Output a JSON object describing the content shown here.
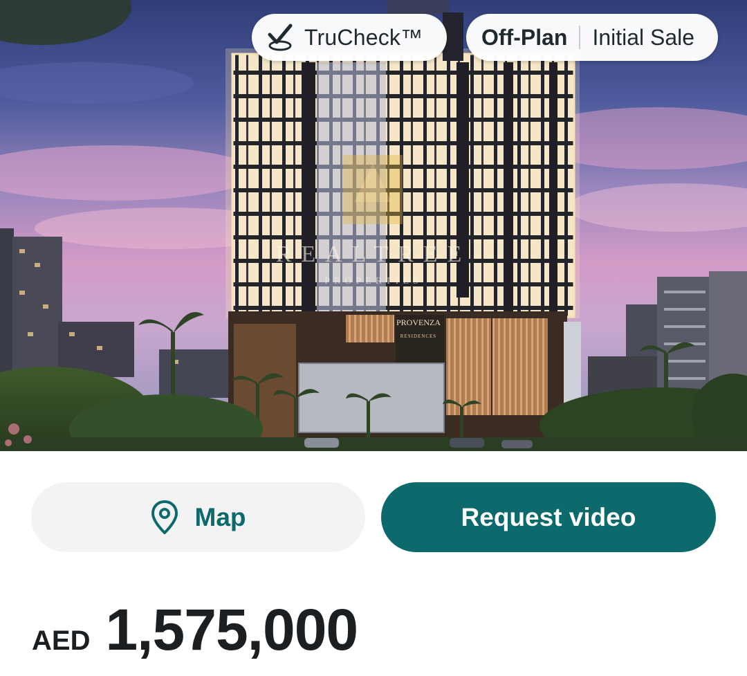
{
  "hero": {
    "watermark_title": "REALTREE",
    "watermark_subtitle": "PROPERTIES",
    "building_sign_1": "PROVENZA",
    "building_sign_2": "RESIDENCES"
  },
  "badges": {
    "trucheck_label": "TruCheck™",
    "status_primary": "Off-Plan",
    "status_secondary": "Initial Sale"
  },
  "actions": {
    "map_label": "Map",
    "request_video_label": "Request video"
  },
  "price": {
    "currency": "AED",
    "amount": "1,575,000"
  },
  "colors": {
    "accent": "#0c6a6d",
    "map_button_bg": "#f3f3f3",
    "text_dark": "#1b1f22"
  },
  "icons": {
    "trucheck": "check-badge-icon",
    "map": "map-pin-icon"
  }
}
